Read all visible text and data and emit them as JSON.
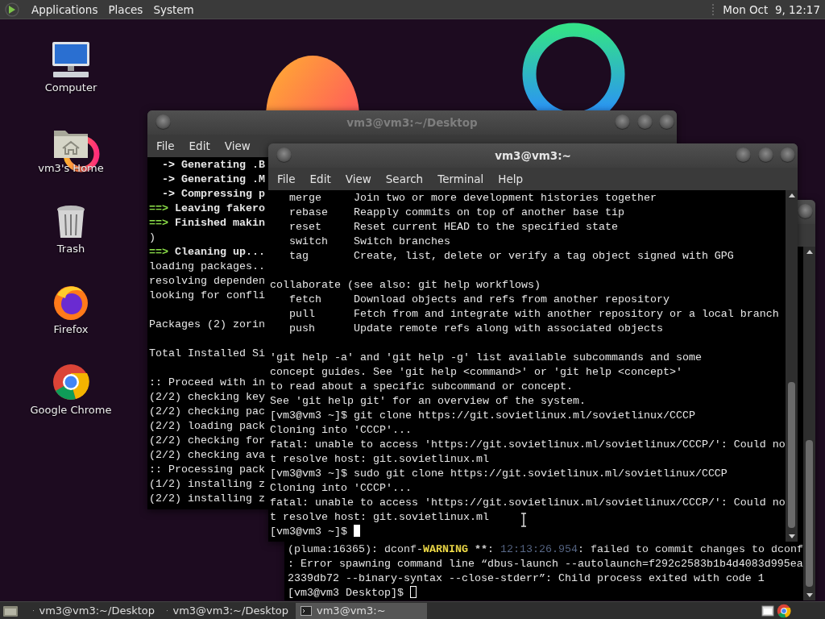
{
  "top_panel": {
    "menus": [
      "Applications",
      "Places",
      "System"
    ],
    "clock": "Mon Oct  9, 12:17"
  },
  "desktop_icons": [
    {
      "kind": "computer",
      "label": "Computer"
    },
    {
      "kind": "home",
      "label": "vm3's Home"
    },
    {
      "kind": "trash",
      "label": "Trash"
    },
    {
      "kind": "firefox",
      "label": "Firefox"
    },
    {
      "kind": "chrome",
      "label": "Google Chrome"
    }
  ],
  "windows": [
    {
      "title": "vm3@vm3:~",
      "active": true,
      "buttons": [
        {
          "kind": "menu"
        },
        {
          "kind": "minimize"
        },
        {
          "kind": "maximize"
        },
        {
          "kind": "close"
        }
      ],
      "menus": [
        "File",
        "Edit",
        "View",
        "Search",
        "Terminal",
        "Help"
      ],
      "lines": [
        {
          "kind": "plain",
          "text": "   merge     Join two or more development histories together"
        },
        {
          "kind": "plain",
          "text": "   rebase    Reapply commits on top of another base tip"
        },
        {
          "kind": "plain",
          "text": "   reset     Reset current HEAD to the specified state"
        },
        {
          "kind": "plain",
          "text": "   switch    Switch branches"
        },
        {
          "kind": "plain",
          "text": "   tag       Create, list, delete or verify a tag object signed with GPG"
        },
        {
          "kind": "blank"
        },
        {
          "kind": "plain",
          "text": "collaborate (see also: git help workflows)"
        },
        {
          "kind": "plain",
          "text": "   fetch     Download objects and refs from another repository"
        },
        {
          "kind": "plain",
          "text": "   pull      Fetch from and integrate with another repository or a local branch"
        },
        {
          "kind": "plain",
          "text": "   push      Update remote refs along with associated objects"
        },
        {
          "kind": "blank"
        },
        {
          "kind": "plain",
          "text": "'git help -a' and 'git help -g' list available subcommands and some"
        },
        {
          "kind": "plain",
          "text": "concept guides. See 'git help <command>' or 'git help <concept>'"
        },
        {
          "kind": "plain",
          "text": "to read about a specific subcommand or concept."
        },
        {
          "kind": "plain",
          "text": "See 'git help git' for an overview of the system."
        },
        {
          "kind": "plain",
          "text": "[vm3@vm3 ~]$ git clone https://git.sovietlinux.ml/sovietlinux/CCCP"
        },
        {
          "kind": "plain",
          "text": "Cloning into 'CCCP'..."
        },
        {
          "kind": "plain",
          "text": "fatal: unable to access 'https://git.sovietlinux.ml/sovietlinux/CCCP/': Could no"
        },
        {
          "kind": "plain",
          "text": "t resolve host: git.sovietlinux.ml"
        },
        {
          "kind": "plain",
          "text": "[vm3@vm3 ~]$ sudo git clone https://git.sovietlinux.ml/sovietlinux/CCCP"
        },
        {
          "kind": "plain",
          "text": "Cloning into 'CCCP'..."
        },
        {
          "kind": "plain",
          "text": "fatal: unable to access 'https://git.sovietlinux.ml/sovietlinux/CCCP/': Could no"
        },
        {
          "kind": "plain",
          "text": "t resolve host: git.sovietlinux.ml"
        },
        {
          "kind": "prompt",
          "text": "[vm3@vm3 ~]$ "
        }
      ]
    },
    {
      "title": "vm3@vm3:~/Desktop",
      "active": false,
      "buttons": [
        {
          "kind": "menu"
        },
        {
          "kind": "minimize"
        },
        {
          "kind": "maximize"
        },
        {
          "kind": "close"
        }
      ],
      "menus": [
        "File",
        "Edit",
        "View"
      ],
      "lines": [
        {
          "kind": "substep",
          "marker": "->",
          "text": "Generating .B"
        },
        {
          "kind": "substep",
          "marker": "->",
          "text": "Generating .M"
        },
        {
          "kind": "substep",
          "marker": "->",
          "text": "Compressing p"
        },
        {
          "kind": "step",
          "marker": "==>",
          "text": "Leaving fakero"
        },
        {
          "kind": "step",
          "marker": "==>",
          "text": "Finished makin"
        },
        {
          "kind": "plain",
          "text": ")"
        },
        {
          "kind": "step",
          "marker": "==>",
          "text": "Cleaning up..."
        },
        {
          "kind": "plain",
          "text": "loading packages.."
        },
        {
          "kind": "plain",
          "text": "resolving dependen"
        },
        {
          "kind": "plain",
          "text": "looking for confli"
        },
        {
          "kind": "blank"
        },
        {
          "kind": "plain",
          "text": "Packages (2) zorin"
        },
        {
          "kind": "blank"
        },
        {
          "kind": "plain",
          "text": "Total Installed Si"
        },
        {
          "kind": "blank"
        },
        {
          "kind": "plain",
          "text": ":: Proceed with in"
        },
        {
          "kind": "plain",
          "text": "(2/2) checking key"
        },
        {
          "kind": "plain",
          "text": "(2/2) checking pac"
        },
        {
          "kind": "plain",
          "text": "(2/2) loading pack"
        },
        {
          "kind": "plain",
          "text": "(2/2) checking for"
        },
        {
          "kind": "plain",
          "text": "(2/2) checking ava"
        },
        {
          "kind": "plain",
          "text": ":: Processing pack"
        },
        {
          "kind": "plain",
          "text": "(1/2) installing z"
        },
        {
          "kind": "plain",
          "text": "(2/2) installing z"
        }
      ]
    },
    {
      "active": false,
      "buttons": [
        {
          "kind": "close"
        }
      ],
      "lines": [
        {
          "kind": "log",
          "parts": [
            {
              "kind": "plain",
              "text": "(pluma:16365): dconf-"
            },
            {
              "kind": "warning",
              "text": "WARNING"
            },
            {
              "kind": "bold",
              "text": " **"
            },
            {
              "kind": "plain",
              "text": ": "
            },
            {
              "kind": "timestamp",
              "text": "12:13:26.954"
            },
            {
              "kind": "plain",
              "text": ": failed to commit changes to dconf"
            }
          ]
        },
        {
          "kind": "plain",
          "text": ": Error spawning command line “dbus-launch --autolaunch=f292c2583b1b4d4083d995ea"
        },
        {
          "kind": "plain",
          "text": "2339db72 --binary-syntax --close-stderr”: Child process exited with code 1"
        },
        {
          "kind": "prompt",
          "text": "[vm3@vm3 Desktop]$ "
        }
      ]
    }
  ],
  "taskbar": {
    "tasks": [
      {
        "label": "vm3@vm3:~/Desktop",
        "selected": false
      },
      {
        "label": "vm3@vm3:~/Desktop",
        "selected": false
      },
      {
        "label": "vm3@vm3:~",
        "selected": true
      }
    ]
  }
}
